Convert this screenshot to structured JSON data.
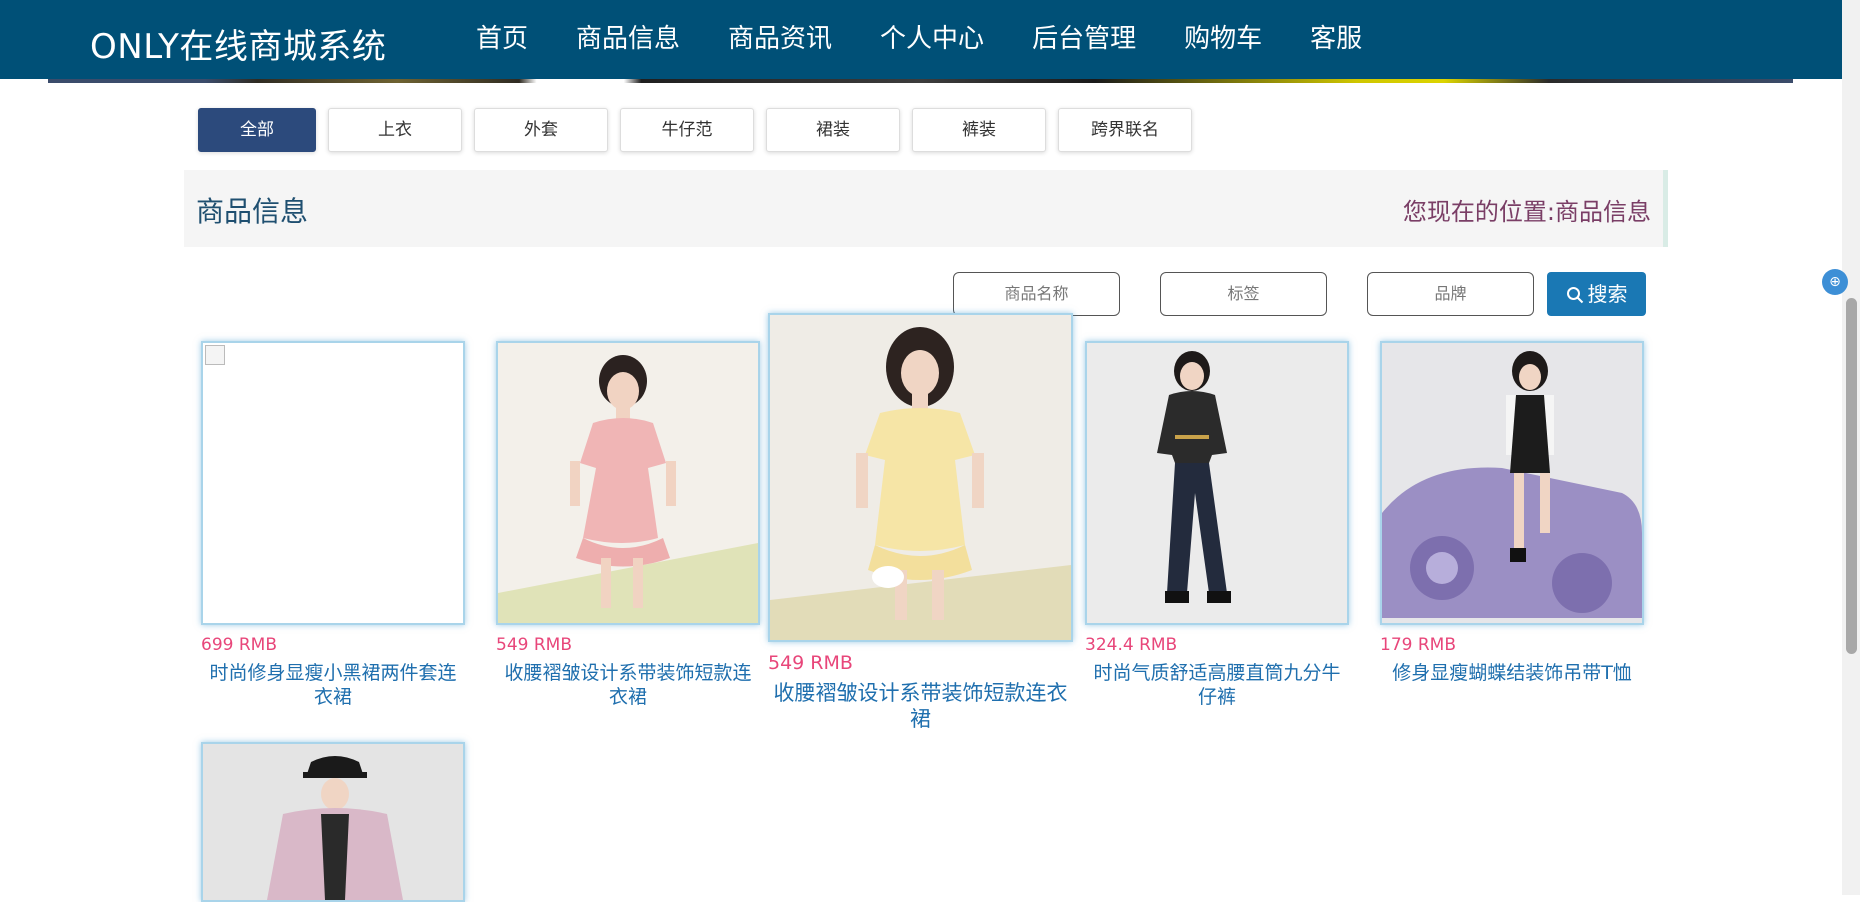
{
  "header": {
    "brand": "ONLY在线商城系统",
    "nav": [
      "首页",
      "商品信息",
      "商品资讯",
      "个人中心",
      "后台管理",
      "购物车",
      "客服"
    ]
  },
  "categories": {
    "items": [
      "全部",
      "上衣",
      "外套",
      "牛仔范",
      "裙装",
      "裤装",
      "跨界联名"
    ],
    "active_index": 0
  },
  "title_bar": {
    "title": "商品信息",
    "location_prefix": "您现在的位置:",
    "location": "商品信息"
  },
  "search": {
    "name_placeholder": "商品名称",
    "tag_placeholder": "标签",
    "brand_placeholder": "品牌",
    "button_label": "搜索"
  },
  "products": [
    {
      "price": "699 RMB",
      "name": "时尚修身显瘦小黑裙两件套连衣裙",
      "image": "broken"
    },
    {
      "price": "549 RMB",
      "name": "收腰褶皱设计系带装饰短款连衣裙",
      "image": "pink-dress"
    },
    {
      "price": "549 RMB",
      "name": "收腰褶皱设计系带装饰短款连衣裙",
      "image": "yellow-dress"
    },
    {
      "price": "324.4 RMB",
      "name": "时尚气质舒适高腰直筒九分牛仔裤",
      "image": "denim-outfit"
    },
    {
      "price": "179 RMB",
      "name": "修身显瘦蝴蝶结装饰吊带T恤",
      "image": "car-outfit"
    },
    {
      "price": "",
      "name": "",
      "image": "jacket-outfit"
    }
  ],
  "colors": {
    "header_bg": "#005077",
    "active_category": "#2c4a7c",
    "price": "#e8467a",
    "product_name": "#1f6fae",
    "search_button": "#1a78b4"
  },
  "icons": [
    "search-icon",
    "broken-image-icon"
  ]
}
